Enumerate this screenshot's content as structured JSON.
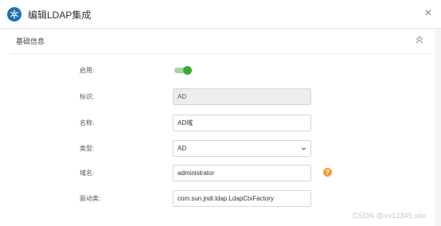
{
  "dialog": {
    "title": "编辑LDAP集成",
    "close_glyph": "×",
    "icon": "snowflake-gear-icon"
  },
  "section": {
    "title": "基础信息",
    "collapse_icon": "double-chevron-up-icon"
  },
  "form": {
    "enabled": {
      "label": "启用:",
      "value": true
    },
    "identifier": {
      "label": "标识:",
      "value": "AD"
    },
    "name": {
      "label": "名称:",
      "value": "AD域"
    },
    "type": {
      "label": "类型:",
      "value": "AD"
    },
    "domain": {
      "label": "域名:",
      "value": "administrator",
      "help_glyph": "?"
    },
    "driver": {
      "label": "驱动类:",
      "value": "com.sun.jndi.ldap.LdapCtxFactory"
    }
  },
  "watermark": "CSDN @vv12345.site",
  "colors": {
    "accent": "#1f6fb7",
    "toggle_on": "#3aaa35",
    "help": "#f39c35"
  }
}
